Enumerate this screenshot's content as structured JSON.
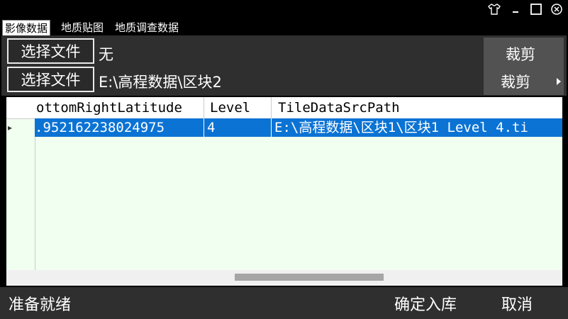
{
  "window": {
    "controls": [
      "shirt-icon",
      "minimize-icon",
      "maximize-icon",
      "close-icon"
    ]
  },
  "tabs": [
    {
      "label": "影像数据",
      "active": true
    },
    {
      "label": "地质贴图",
      "active": false
    },
    {
      "label": "地质调查数据",
      "active": false
    }
  ],
  "file_rows": [
    {
      "button_label": "选择文件",
      "path": "无"
    },
    {
      "button_label": "选择文件",
      "path": "E:\\高程数据\\区块2"
    }
  ],
  "crop": {
    "label_top": "裁剪",
    "label_bottom": "裁剪"
  },
  "table": {
    "columns": [
      "ottomRightLatitude",
      "Level",
      "TileDataSrcPath"
    ],
    "rows": [
      [
        "952162238024975",
        "4",
        "E:\\高程数据\\区块1\\区块1 Level 4.ti"
      ]
    ],
    "selected_row": 0,
    "row_indicator": "▸"
  },
  "status_bar": {
    "status_text": "准备就绪",
    "confirm_label": "确定入库",
    "cancel_label": "取消"
  },
  "colors": {
    "background": "#000000",
    "panel": "#2f2f2f",
    "selection": "#0b73d4",
    "grid_background": "#f0fff0"
  }
}
